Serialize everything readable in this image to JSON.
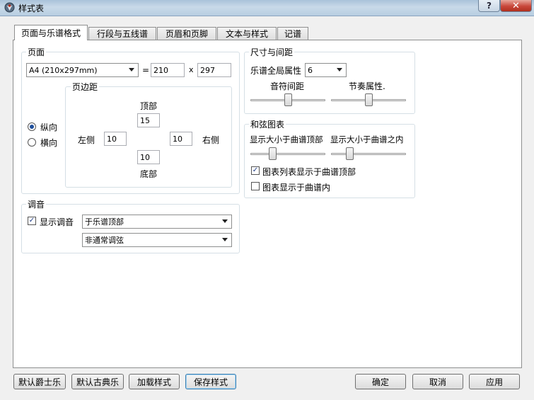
{
  "window": {
    "title": "样式表",
    "help_label": "?",
    "close_label": "✕"
  },
  "tabs": [
    {
      "label": "页面与乐谱格式",
      "active": true
    },
    {
      "label": "行段与五线谱"
    },
    {
      "label": "页眉和页脚"
    },
    {
      "label": "文本与样式"
    },
    {
      "label": "记谱"
    }
  ],
  "page": {
    "legend": "页面",
    "paper_size": "A4 (210x297mm)",
    "equals": "=",
    "width": "210",
    "times": "x",
    "height": "297",
    "orientation": {
      "portrait": "纵向",
      "landscape": "横向",
      "selected": "portrait"
    },
    "margins": {
      "legend": "页边距",
      "top_label": "顶部",
      "top": "15",
      "left_label": "左侧",
      "left": "10",
      "right_label": "右侧",
      "right": "10",
      "bottom_label": "底部",
      "bottom": "10"
    }
  },
  "tuning": {
    "legend": "调音",
    "show_label": "显示调音",
    "show_checked": true,
    "position": "于乐谱顶部",
    "kind": "非通常调弦"
  },
  "size_spacing": {
    "legend": "尺寸与间距",
    "global_label": "乐谱全局属性",
    "global_value": "6",
    "note_spacing_label": "音符间距",
    "note_spacing_value": 0.5,
    "rhythm_label": "节奏属性.",
    "rhythm_value": 0.5
  },
  "chord_diagrams": {
    "legend": "和弦图表",
    "size_top_label": "显示大小于曲谱顶部",
    "size_top_value": 0.3,
    "size_inside_label": "显示大小于曲谱之内",
    "size_inside_value": 0.25,
    "list_top_label": "图表列表显示于曲谱顶部",
    "list_top_checked": true,
    "inside_label": "图表显示于曲谱内",
    "inside_checked": false
  },
  "buttons": {
    "jazz": "默认爵士乐",
    "classical": "默认古典乐",
    "load": "加载样式",
    "save": "保存样式",
    "ok": "确定",
    "cancel": "取消",
    "apply": "应用"
  }
}
